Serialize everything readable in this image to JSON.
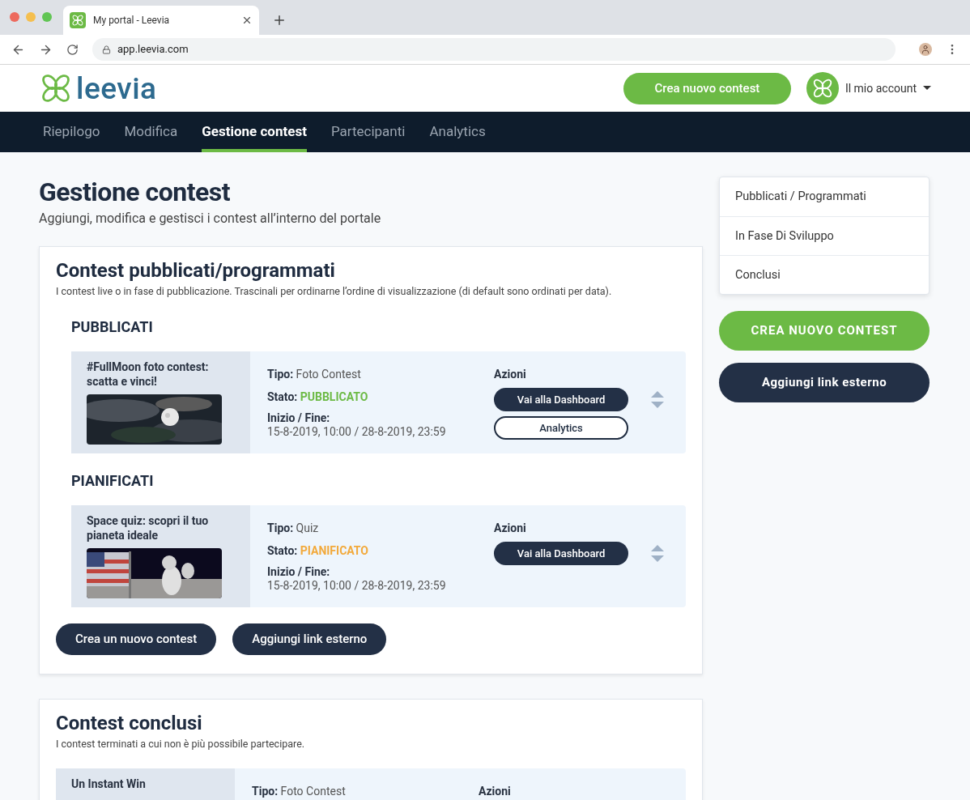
{
  "browser": {
    "tab_title": "My portal - Leevia",
    "url": "app.leevia.com"
  },
  "header": {
    "logo": "leevia",
    "create_button": "Crea nuovo contest",
    "account": "Il mio account"
  },
  "nav": [
    {
      "label": "Riepilogo",
      "selected": false
    },
    {
      "label": "Modifica",
      "selected": false
    },
    {
      "label": "Gestione contest",
      "selected": true
    },
    {
      "label": "Partecipanti",
      "selected": false
    },
    {
      "label": "Analytics",
      "selected": false
    }
  ],
  "page": {
    "title": "Gestione contest",
    "subtitle": "Aggiungi, modifica e gestisci i contest all’interno del portale"
  },
  "sections": [
    {
      "title": "Contest pubblicati/programmati",
      "description": "I contest live o in fase di pubblicazione. Trascinali per ordinarne l’ordine di visualizzazione (di default sono ordinati per data).",
      "groups": [
        {
          "heading": "PUBBLICATI",
          "contests": [
            {
              "title": "#FullMoon foto contest: scatta e vinci!",
              "picture": {
                "kind": "picture"
              },
              "type_label": "Tipo:",
              "type": "Foto Contest",
              "status_label": "Stato:",
              "status": "PUBBLICATO",
              "color": "#6cba45",
              "dates_label": "Inizio / Fine:",
              "dates": "15-8-2019, 10:00 / 28-8-2019, 23:59",
              "actions_label": "Azioni",
              "actions": [
                {
                  "label": "Vai alla Dashboard",
                  "kind": "filled"
                },
                {
                  "label": "Analytics",
                  "kind": "outline"
                }
              ]
            }
          ]
        },
        {
          "heading": "PIANIFICATI",
          "contests": [
            {
              "title": "Space quiz: scopri il tuo pianeta ideale",
              "picture": {
                "kind": "picture"
              },
              "type_label": "Tipo:",
              "type": "Quiz",
              "status_label": "Stato:",
              "status": "PIANIFICATO",
              "color": "#f2a93b",
              "dates_label": "Inizio / Fine:",
              "dates": "15-8-2019, 10:00 / 28-8-2019, 23:59",
              "actions_label": "Azioni",
              "actions": [
                {
                  "label": "Vai alla Dashboard",
                  "kind": "filled"
                }
              ]
            }
          ]
        }
      ],
      "buttons": [
        "Crea un nuovo contest",
        "Aggiungi link esterno"
      ]
    },
    {
      "title": "Contest conclusi",
      "description": "I contest terminati a cui non è più possibile partecipare.",
      "groups": [
        {
          "contests": [
            {
              "title": "Un Instant Win",
              "type_label": "Tipo:",
              "type": "Foto Contest",
              "actions_label": "Azioni"
            }
          ]
        }
      ]
    }
  ],
  "sidebar": {
    "items": [
      "Pubblicati / Programmati",
      "In Fase Di Sviluppo",
      "Conclusi"
    ],
    "primary_button": "CREA NUOVO CONTEST",
    "secondary_button": "Aggiungi link esterno"
  }
}
